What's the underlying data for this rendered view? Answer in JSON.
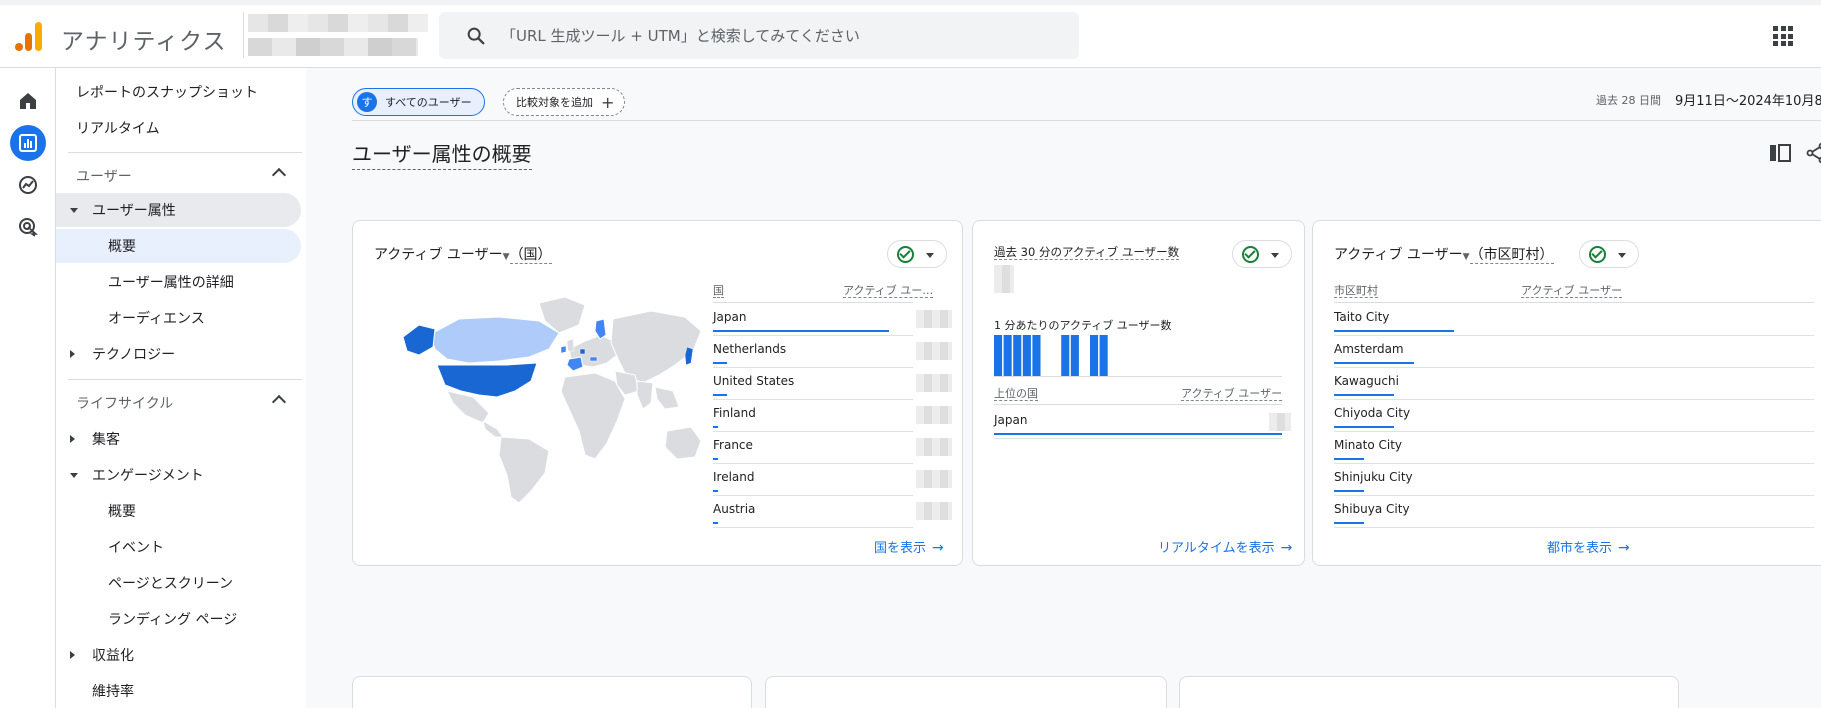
{
  "app": {
    "title": "アナリティクス"
  },
  "search": {
    "placeholder": "「URL 生成ツール + UTM」と検索してみてください"
  },
  "rail": {
    "items": [
      "home-icon",
      "reports-icon",
      "explore-icon",
      "advertising-icon"
    ]
  },
  "nav": {
    "top_items": [
      "レポートのスナップショット",
      "リアルタイム"
    ],
    "user_section": "ユーザー",
    "user_attr_group": "ユーザー属性",
    "user_attr_items": [
      "概要",
      "ユーザー属性の詳細",
      "オーディエンス"
    ],
    "technology": "テクノロジー",
    "lifecycle_section": "ライフサイクル",
    "acquisition": "集客",
    "engagement": "エンゲージメント",
    "engagement_items": [
      "概要",
      "イベント",
      "ページとスクリーン",
      "ランディング ページ"
    ],
    "monetization": "収益化",
    "retention": "維持率"
  },
  "header": {
    "chip_avatar": "す",
    "chip_all_users": "すべてのユーザー",
    "chip_compare": "比較対象を追加",
    "date_label": "過去 28 日間",
    "date_range": "9月11日～2024年10月8",
    "page_title": "ユーザー属性の概要"
  },
  "card_country": {
    "title_metric": "アクティブ ユーザー",
    "title_dim": "（国）",
    "col_country": "国",
    "col_users": "アクティブ ユー…",
    "rows": [
      {
        "name": "Japan",
        "share": 0.88
      },
      {
        "name": "Netherlands",
        "share": 0.07
      },
      {
        "name": "United States",
        "share": 0.07
      },
      {
        "name": "Finland",
        "share": 0.025
      },
      {
        "name": "France",
        "share": 0.025
      },
      {
        "name": "Ireland",
        "share": 0.025
      },
      {
        "name": "Austria",
        "share": 0.025
      }
    ],
    "link": "国を表示"
  },
  "card_realtime": {
    "title": "過去 30 分のアクティブ ユーザー数",
    "subtitle": "1 分あたりのアクティブ ユーザー数",
    "minute_bars": [
      1,
      1,
      1,
      1,
      1,
      0,
      0,
      1,
      1,
      0,
      1,
      1,
      0,
      0,
      0,
      0,
      0,
      0,
      0,
      0,
      0,
      0,
      0,
      0,
      0,
      0,
      0,
      0,
      0,
      0
    ],
    "col_country": "上位の国",
    "col_users": "アクティブ ユーザー",
    "rows": [
      {
        "name": "Japan",
        "share": 1.0
      }
    ],
    "link": "リアルタイムを表示"
  },
  "card_city": {
    "title_metric": "アクティブ ユーザー",
    "title_dim": "（市区町村）",
    "col_city": "市区町村",
    "col_users": "アクティブ ユーザー",
    "rows": [
      {
        "name": "Taito City",
        "share": 0.6
      },
      {
        "name": "Amsterdam",
        "share": 0.4
      },
      {
        "name": "Kawaguchi",
        "share": 0.3
      },
      {
        "name": "Chiyoda City",
        "share": 0.3
      },
      {
        "name": "Minato City",
        "share": 0.15
      },
      {
        "name": "Shinjuku City",
        "share": 0.15
      },
      {
        "name": "Shibuya City",
        "share": 0.15
      }
    ],
    "link": "都市を表示"
  },
  "colors": {
    "accent": "#1a73e8",
    "map_high": "#1967d2",
    "map_mid": "#4285f4",
    "map_low": "#aecbfa",
    "map_none": "#dadce0"
  }
}
